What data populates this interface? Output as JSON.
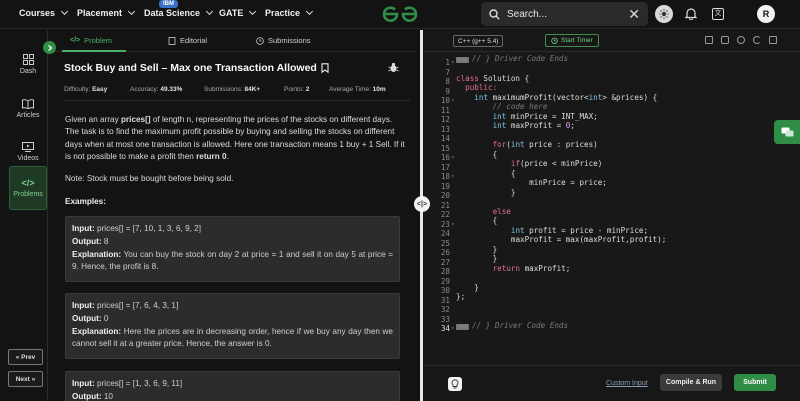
{
  "nav": {
    "courses": "Courses",
    "placement": "Placement",
    "data_science": "Data Science",
    "ibm_badge": "IBM",
    "gate": "GATE",
    "practice": "Practice",
    "search_placeholder": "Search...",
    "avatar_letter": "R"
  },
  "rail": {
    "dash": "Dash",
    "articles": "Articles",
    "videos": "Videos",
    "problems": "Problems",
    "prev": "« Prev",
    "next": "Next »"
  },
  "problem": {
    "tabs": {
      "problem": "Problem",
      "editorial": "Editorial",
      "submissions": "Submissions"
    },
    "title": "Stock Buy and Sell – Max one Transaction Allowed",
    "meta": {
      "difficulty_label": "Difficulty:",
      "difficulty": "Easy",
      "accuracy_label": "Accuracy:",
      "accuracy": "49.33%",
      "submissions_label": "Submissions:",
      "submissions": "84K+",
      "points_label": "Points:",
      "points": "2",
      "avg_time_label": "Average Time:",
      "avg_time": "10m"
    },
    "desc_1": "Given an array ",
    "desc_bold_1": "prices[]",
    "desc_2": " of length n, representing the prices of the stocks on different days. The task is to find the maximum profit possible by buying and selling the stocks on different days when at most one transaction is allowed. Here one transaction means 1 buy + 1 Sell. If it is not possible to make a profit then ",
    "desc_bold_2": "return 0",
    "desc_3": ".",
    "note": "Note: Stock must be bought before being sold.",
    "examples_heading": "Examples:",
    "examples": [
      {
        "input_label": "Input:",
        "input": " prices[] = [7, 10, 1, 3, 6, 9, 2]",
        "output_label": "Output:",
        "output": " 8",
        "explanation_label": "Explanation:",
        "explanation": " You can buy the stock on day 2 at price = 1 and sell it on day 5 at price = 9. Hence, the profit is 8."
      },
      {
        "input_label": "Input:",
        "input": " prices[] = [7, 6, 4, 3, 1]",
        "output_label": "Output:",
        "output": " 0",
        "explanation_label": "Explanation:",
        "explanation": " Here the prices are in decreasing order, hence if we buy any day then we cannot sell it at a greater price. Hence, the answer is 0."
      },
      {
        "input_label": "Input:",
        "input": " prices[] = [1, 3, 6, 9, 11]",
        "output_label": "Output:",
        "output": " 10"
      }
    ]
  },
  "editor": {
    "language": "C++ (g++ 5.4)",
    "start_timer": "Start Timer",
    "custom_input": "Custom Input",
    "compile_run": "Compile & Run",
    "submit": "Submit",
    "line_numbers": [
      "1",
      "7",
      "8",
      "9",
      "10",
      "11",
      "12",
      "13",
      "14",
      "15",
      "16",
      "17",
      "18",
      "19",
      "20",
      "21",
      "22",
      "23",
      "24",
      "25",
      "26",
      "27",
      "28",
      "29",
      "30",
      "31",
      "32",
      "33",
      "34"
    ],
    "driver_start": "// } Driver Code Ends",
    "driver_end": "// } Driver Code Ends",
    "code": {
      "l8_kw": "class",
      "l8_rest": " Solution {",
      "l9": "  public:",
      "l10_ty": "int",
      "l10_a": " maximumProfit(vector<",
      "l10_ty2": "int",
      "l10_b": "> &prices) {",
      "l11": "// code here",
      "l12_ty": "int",
      "l12_rest": " minPrice = INT_MAX;",
      "l13_ty": "int",
      "l13_a": " maxProfit = ",
      "l13_num": "0",
      "l13_b": ";",
      "l15_kw": "for",
      "l15_a": "(",
      "l15_ty": "int",
      "l15_b": " price : prices)",
      "l16": "{",
      "l17_kw": "if",
      "l17_rest": "(price < minPrice)",
      "l18": "{",
      "l19": "minPrice = price;",
      "l20": "}",
      "l22_kw": "else",
      "l23": "{",
      "l24_ty": "int",
      "l24_rest": " profit = price - minPrice;",
      "l25": "maxProfit = max(maxProfit,profit);",
      "l26": "}",
      "l27": "}",
      "l28_kw": "return",
      "l28_rest": " maxProfit;",
      "l30": "}",
      "l31": "};"
    }
  }
}
